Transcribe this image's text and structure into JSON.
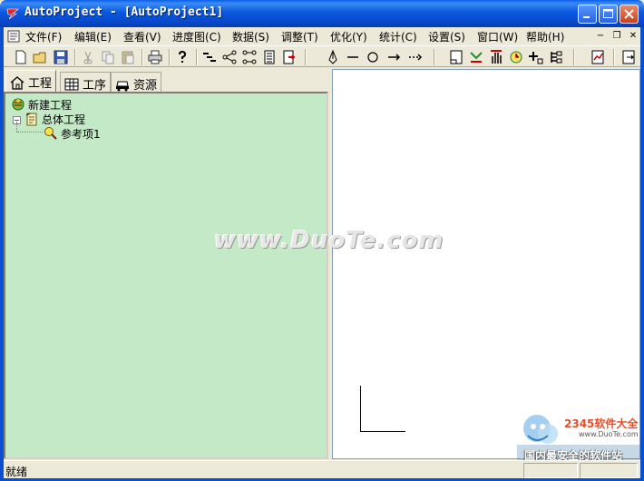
{
  "window": {
    "title": "AutoProject - [AutoProject1]"
  },
  "menu": {
    "items": [
      "文件(F)",
      "编辑(E)",
      "查看(V)",
      "进度图(C)",
      "数据(S)",
      "调整(T)",
      "优化(Y)",
      "统计(C)",
      "设置(S)",
      "窗口(W)",
      "帮助(H)"
    ],
    "mdi_min": "−",
    "mdi_restore": "❐",
    "mdi_close": "✕"
  },
  "tabs": [
    {
      "label": "工程",
      "icon": "house-icon"
    },
    {
      "label": "工序",
      "icon": "grid-icon"
    },
    {
      "label": "资源",
      "icon": "car-icon"
    }
  ],
  "tree": {
    "root": "新建工程",
    "child": "总体工程",
    "leaf": "参考项1",
    "expander": "−"
  },
  "watermark": "www.DuoTe.com",
  "corner": {
    "brand": "2345软件大全",
    "url": "www.DuoTe.com",
    "slogan": "国内最安全的软件站"
  },
  "status": {
    "text": "就绪"
  },
  "colors": {
    "tree_bg": "#c4e9c6",
    "titlebar": "#0a5ee8"
  }
}
